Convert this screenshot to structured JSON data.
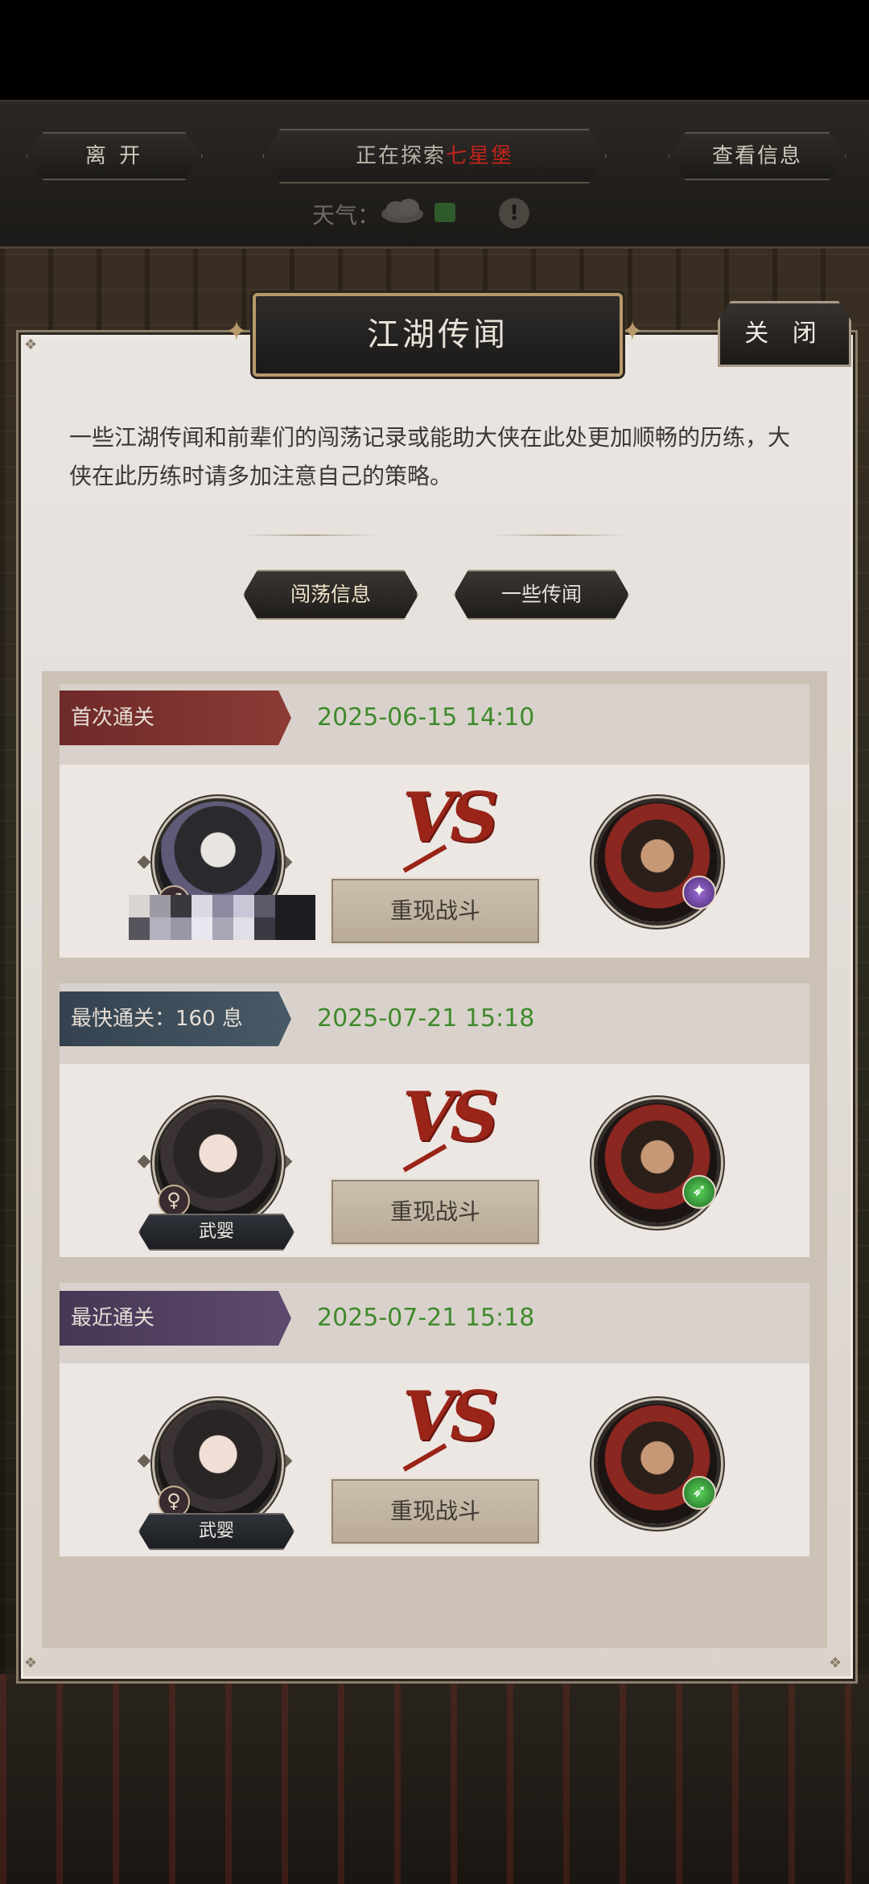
{
  "topbar": {
    "leave_label": "离 开",
    "exploring_prefix": "正在探索",
    "location_name": "七星堡",
    "info_label": "查看信息",
    "weather_label": "天气：",
    "info_icon": "!"
  },
  "panel": {
    "title": "江湖传闻",
    "close_label": "关 闭",
    "description": "一些江湖传闻和前辈们的闯荡记录或能助大侠在此处更加顺畅的历练，大侠在此历练时请多加注意自己的策略。",
    "tabs": [
      {
        "label": "闯荡信息",
        "active": true
      },
      {
        "label": "一些传闻",
        "active": false
      }
    ]
  },
  "records": [
    {
      "ribbon": "首次通关",
      "date": "2025-06-15 14:10",
      "player_name": "",
      "player_gender_symbol": "♂",
      "vs": "VS",
      "replay_label": "重现战斗",
      "enemy_element": "purple"
    },
    {
      "ribbon": "最快通关：160 息",
      "date": "2025-07-21 15:18",
      "player_name": "武婴",
      "player_gender_symbol": "♀",
      "vs": "VS",
      "replay_label": "重现战斗",
      "enemy_element": "green"
    },
    {
      "ribbon": "最近通关",
      "date": "2025-07-21 15:18",
      "player_name": "武婴",
      "player_gender_symbol": "♀",
      "vs": "VS",
      "replay_label": "重现战斗",
      "enemy_element": "green"
    }
  ],
  "colors": {
    "date_green": "#3f8a2c",
    "location_red": "#c0241c",
    "ribbon_red": "#6e2a29",
    "ribbon_slate": "#34424f",
    "ribbon_purple": "#463754"
  }
}
